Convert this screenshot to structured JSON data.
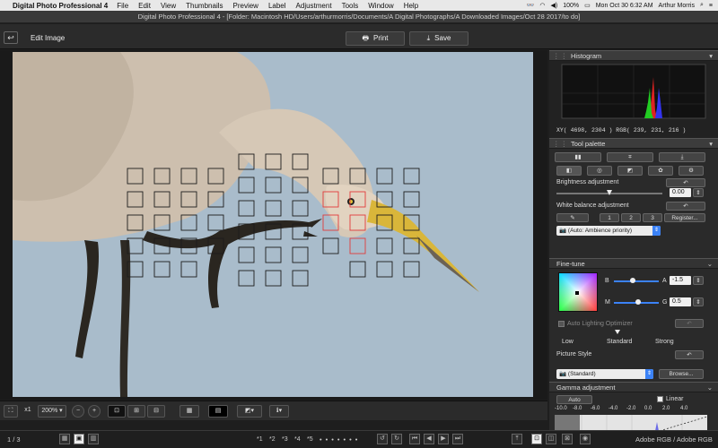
{
  "menubar": {
    "app": "Digital Photo Professional 4",
    "items": [
      "File",
      "Edit",
      "View",
      "Thumbnails",
      "Preview",
      "Label",
      "Adjustment",
      "Tools",
      "Window",
      "Help"
    ],
    "battery": "100%",
    "clock": "Mon Oct 30  6:32 AM",
    "user": "Arthur Morris"
  },
  "window": {
    "title": "Digital Photo Professional 4 - [Folder: Macintosh HD/Users/arthurmorris/Documents/A Digital Photographs/A Downloaded Images/Oct 28 2017/to do]"
  },
  "toolbar": {
    "edit_image": "Edit Image",
    "print_label": "Print",
    "save_label": "Save"
  },
  "histogram": {
    "title": "Histogram",
    "readout": "XY( 4698,  2304 ) RGB( 239,  231,  216 )"
  },
  "tool_palette": {
    "title": "Tool palette",
    "brightness_label": "Brightness adjustment",
    "brightness_value": "0.00",
    "brightness_level": 0.5,
    "wb_label": "White balance adjustment",
    "wb_presets": [
      "1",
      "2",
      "3"
    ],
    "register_label": "Register...",
    "wb_mode": "(Auto: Ambience priority)"
  },
  "finetune": {
    "title": "Fine-tune",
    "b_label": "B",
    "a_label": "A",
    "m_label": "M",
    "g_label": "G",
    "a_value": "-1.5",
    "g_value": "0.5",
    "alo_label": "Auto Lighting Optimizer",
    "levels": [
      "Low",
      "Standard",
      "Strong"
    ],
    "picture_style_label": "Picture Style",
    "picture_style_value": "(Standard)",
    "browse_label": "Browse..."
  },
  "gamma": {
    "title": "Gamma adjustment",
    "auto_label": "Auto",
    "linear_label": "Linear",
    "ticks": [
      "-10.0",
      "-8.0",
      "-6.0",
      "-4.0",
      "-2.0",
      "0.0",
      "2.0",
      "4.0"
    ]
  },
  "bottombar": {
    "zoom_x1": "x1",
    "zoom": "200%"
  },
  "statusbar": {
    "page": "1 / 3",
    "ratings": [
      "*1",
      "*2",
      "*3",
      "*4",
      "*5"
    ],
    "color_space": "Adobe RGB / Adobe RGB"
  },
  "colors": {
    "accent": "#3b82f6",
    "sky": "#a9bccb",
    "af_point_active": "#e23b3b"
  }
}
